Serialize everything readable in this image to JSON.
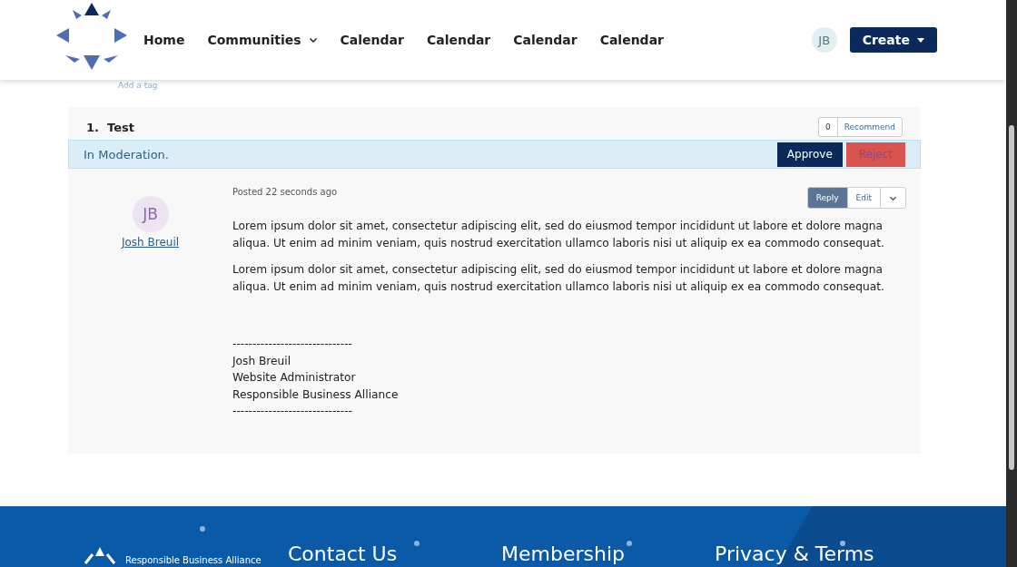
{
  "nav": {
    "items": [
      {
        "label": "Home",
        "dropdown": false
      },
      {
        "label": "Communities",
        "dropdown": true
      },
      {
        "label": "Calendar",
        "dropdown": false
      },
      {
        "label": "Calendar",
        "dropdown": false
      },
      {
        "label": "Calendar",
        "dropdown": false
      },
      {
        "label": "Calendar",
        "dropdown": false
      }
    ],
    "user_initials": "JB",
    "create_button": "Create"
  },
  "tag_link": "Add a tag",
  "post": {
    "number": "1.",
    "title": "Test",
    "recommend_count": "0",
    "recommend_label": "Recommend",
    "moderation": {
      "message": "In Moderation.",
      "approve": "Approve",
      "reject": "Reject"
    },
    "author": {
      "initials": "JB",
      "name": "Josh Breuil"
    },
    "posted": "Posted 22 seconds ago",
    "actions": {
      "reply": "Reply",
      "edit": "Edit"
    },
    "paragraphs": [
      "Lorem ipsum dolor sit amet, consectetur adipiscing elit, sed do eiusmod tempor incididunt ut labore et dolore magna aliqua. Ut enim ad minim veniam, quis nostrud exercitation ullamco laboris nisi ut aliquip ex ea commodo consequat.",
      "Lorem ipsum dolor sit amet, consectetur adipiscing elit, sed do eiusmod tempor incididunt ut labore et dolore magna aliqua. Ut enim ad minim veniam, quis nostrud exercitation ullamco laboris nisi ut aliquip ex ea commodo consequat."
    ],
    "signature": [
      "------------------------------",
      "Josh Breuil",
      "Website Administrator",
      "Responsible Business Alliance",
      "------------------------------"
    ]
  },
  "footer": {
    "brand": "Responsible Business Alliance",
    "headings": [
      "Contact Us",
      "Membership",
      "Privacy & Terms"
    ]
  }
}
